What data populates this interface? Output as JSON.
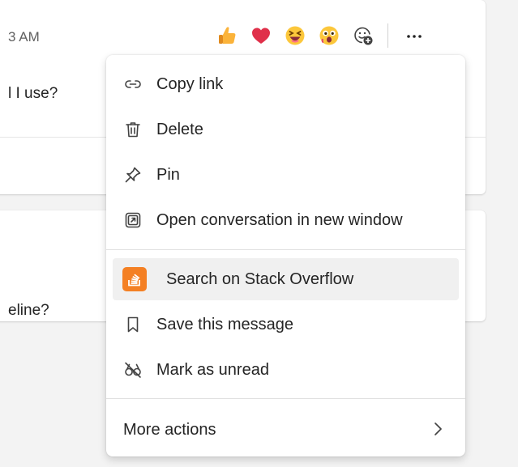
{
  "background_message": {
    "timestamp_fragment": "3 AM",
    "question_fragment_1": "l I use?",
    "question_fragment_2": "eline?"
  },
  "reactions": [
    {
      "name": "like",
      "icon": "thumbs-up-icon"
    },
    {
      "name": "heart",
      "icon": "heart-icon"
    },
    {
      "name": "laugh",
      "icon": "laughing-face-icon"
    },
    {
      "name": "surprised",
      "icon": "surprised-face-icon"
    },
    {
      "name": "more-reactions",
      "icon": "add-reaction-icon"
    }
  ],
  "more_options_icon": "ellipsis-icon",
  "menu": {
    "items": [
      {
        "label": "Copy link",
        "icon": "link-icon"
      },
      {
        "label": "Delete",
        "icon": "trash-icon"
      },
      {
        "label": "Pin",
        "icon": "pin-icon"
      },
      {
        "label": "Open conversation in new window",
        "icon": "open-window-icon"
      },
      {
        "label": "Search on Stack Overflow",
        "icon": "stack-overflow-icon",
        "highlighted": true
      },
      {
        "label": "Save this message",
        "icon": "bookmark-icon"
      },
      {
        "label": "Mark as unread",
        "icon": "mark-unread-icon"
      }
    ],
    "more_actions": {
      "label": "More actions",
      "icon": "chevron-right-icon"
    }
  },
  "colors": {
    "accent_stack_overflow": "#f48024",
    "highlight": "#f0f0f0",
    "text": "#242424"
  }
}
